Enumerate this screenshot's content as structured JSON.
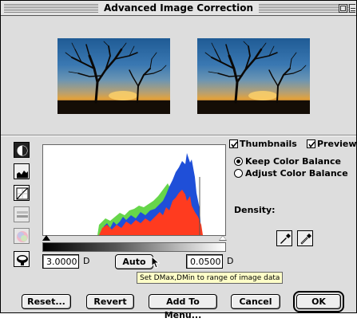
{
  "window": {
    "title": "Advanced Image Correction"
  },
  "thumbnails": {
    "original_alt": "tree-silhouette-sunset-thumbnail",
    "corrected_alt": "tree-silhouette-sunset-thumbnail"
  },
  "tools": [
    {
      "name": "contrast-tool-icon",
      "active": true
    },
    {
      "name": "histogram-tool-icon",
      "active": false
    },
    {
      "name": "curves-tool-icon",
      "active": false
    },
    {
      "name": "levels-tool-icon",
      "active": false
    },
    {
      "name": "color-wheel-tool-icon",
      "active": false
    },
    {
      "name": "saturation-tool-icon",
      "active": false
    }
  ],
  "options": {
    "thumbnails_label": "Thumbnails",
    "thumbnails_checked": true,
    "preview_label": "Preview",
    "preview_checked": true,
    "keep_color_balance_label": "Keep Color Balance",
    "adjust_color_balance_label": "Adjust Color Balance",
    "selected_balance": "keep"
  },
  "density": {
    "label": "Density:",
    "dmax_value": "3.0000",
    "dmax_unit": "D",
    "dmin_value": "0.0500",
    "dmin_unit": "D",
    "auto_label": "Auto",
    "tooltip": "Set DMax,DMin to range of image data"
  },
  "buttons": {
    "reset": "Reset...",
    "revert": "Revert",
    "add_to_menu": "Add To Menu...",
    "cancel": "Cancel",
    "ok": "OK"
  },
  "colors": {
    "histogram_red": "#ff3b1f",
    "histogram_green": "#66d64a",
    "histogram_blue": "#1f4fd8",
    "tooltip_bg": "#ffffc8"
  }
}
